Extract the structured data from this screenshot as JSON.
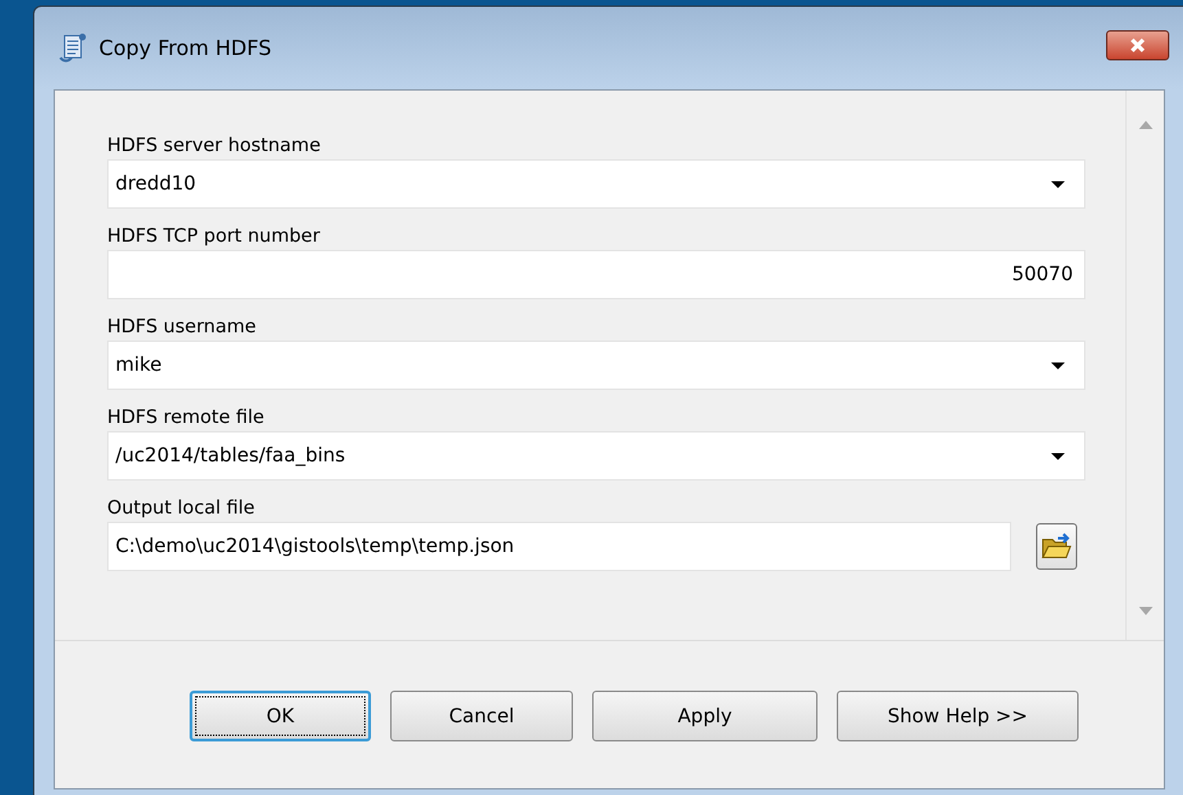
{
  "window": {
    "title": "Copy From HDFS"
  },
  "parameters": [
    {
      "label": "HDFS server hostname",
      "kind": "combo",
      "value": "dredd10"
    },
    {
      "label": "HDFS TCP port number",
      "kind": "number",
      "value": "50070"
    },
    {
      "label": "HDFS username",
      "kind": "combo",
      "value": "mike"
    },
    {
      "label": "HDFS remote file",
      "kind": "combo",
      "value": "/uc2014/tables/faa_bins"
    },
    {
      "label": "Output local file",
      "kind": "file",
      "value": "C:\\demo\\uc2014\\gistools\\temp\\temp.json"
    }
  ],
  "buttons": [
    {
      "label": "OK",
      "focused": true
    },
    {
      "label": "Cancel",
      "focused": false
    },
    {
      "label": "Apply",
      "focused": false
    },
    {
      "label": "Show Help >>",
      "focused": false
    }
  ]
}
